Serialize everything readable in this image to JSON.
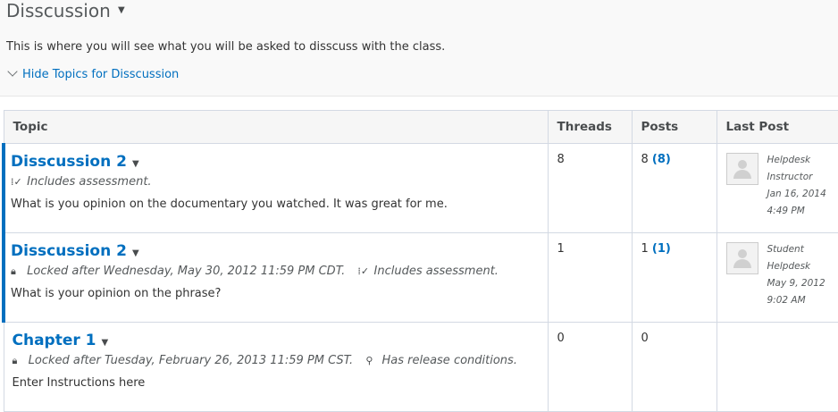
{
  "header": {
    "title": "Disscussion",
    "description": "This is where you will see what you will be asked to disscuss with the class.",
    "hide_topics_label": "Hide Topics for Disscussion"
  },
  "columns": {
    "topic": "Topic",
    "threads": "Threads",
    "posts": "Posts",
    "last_post": "Last Post"
  },
  "topics": [
    {
      "title": "Disscussion 2",
      "locked_text": "",
      "assessment_text": "Includes assessment.",
      "release_text": "",
      "description": "What is you opinion on the documentary you watched. It was great for me.",
      "threads": "8",
      "posts": "8",
      "posts_unread": "(8)",
      "last_post": {
        "author": "Helpdesk",
        "role": "Instructor",
        "date": "Jan 16, 2014",
        "time": "4:49 PM"
      }
    },
    {
      "title": "Disscussion 2",
      "locked_text": "Locked after Wednesday, May 30, 2012 11:59 PM CDT.",
      "assessment_text": "Includes assessment.",
      "release_text": "",
      "description": "What is your opinion on the phrase?",
      "threads": "1",
      "posts": "1",
      "posts_unread": "(1)",
      "last_post": {
        "author": "Student",
        "role": "Helpdesk",
        "date": "May 9, 2012",
        "time": "9:02 AM"
      }
    },
    {
      "title": "Chapter 1",
      "locked_text": "Locked after Tuesday, February 26, 2013 11:59 PM CST.",
      "assessment_text": "",
      "release_text": "Has release conditions.",
      "description": "Enter Instructions here",
      "threads": "0",
      "posts": "0",
      "posts_unread": ""
    }
  ],
  "colors": {
    "link": "#006fbf",
    "accent_bar": "#006fbf"
  },
  "icons": [
    "chevron-down-icon",
    "caret-down-icon",
    "assessment-icon",
    "lock-icon",
    "release-conditions-icon",
    "avatar-icon"
  ]
}
